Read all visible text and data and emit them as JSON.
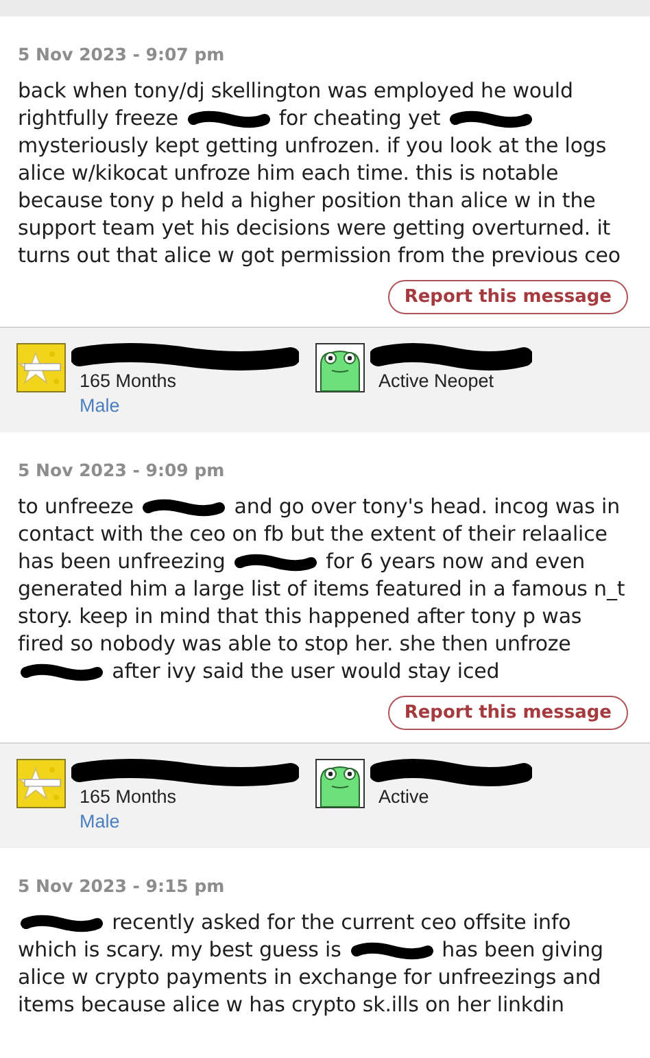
{
  "posts": [
    {
      "date": "5 Nov 2023 - 9:07 pm",
      "body": [
        {
          "kind": "text",
          "text": "back when tony/dj skellington was employed he would rightfully freeze "
        },
        {
          "kind": "redacted"
        },
        {
          "kind": "text",
          "text": " for cheating yet "
        },
        {
          "kind": "redacted"
        },
        {
          "kind": "text",
          "text": " mysteriously kept getting unfrozen. if you look at the logs alice w/kikocat unfroze him each time. this is notable because tony p held a higher position than alice w in the support team yet his decisions were getting overturned. it turns out that alice w got permission from the previous ceo"
        }
      ],
      "report_button": "Report this message",
      "author": {
        "name_redacted": true,
        "months": "165 Months",
        "gender": "Male",
        "pet_name_redacted": true,
        "pet_status": "Active Neopet"
      }
    },
    {
      "date": "5 Nov 2023 - 9:09 pm",
      "body": [
        {
          "kind": "text",
          "text": "to unfreeze "
        },
        {
          "kind": "redacted"
        },
        {
          "kind": "text",
          "text": " and go over tony's head. incog was in contact with the ceo on fb but the extent of their relaalice has been unfreezing "
        },
        {
          "kind": "redacted"
        },
        {
          "kind": "text",
          "text": " for 6 years now and even generated him a large list of items featured in a famous n_t story. keep in mind that this happened after tony p was fired so nobody was able to stop her. she then unfroze "
        },
        {
          "kind": "redacted"
        },
        {
          "kind": "text",
          "text": " after ivy said the user would stay iced"
        }
      ],
      "report_button": "Report this message",
      "author": {
        "name_redacted": true,
        "months": "165 Months",
        "gender": "Male",
        "pet_name_redacted": true,
        "pet_status": "Active"
      }
    },
    {
      "date": "5 Nov 2023 - 9:15 pm",
      "body": [
        {
          "kind": "redacted"
        },
        {
          "kind": "text",
          "text": " recently asked for the current ceo offsite info which is scary. my best guess is "
        },
        {
          "kind": "redacted"
        },
        {
          "kind": "text",
          "text": " has been giving alice w crypto payments in exchange for unfreezings and items because alice w has crypto sk.ills on her linkdin"
        }
      ]
    }
  ]
}
